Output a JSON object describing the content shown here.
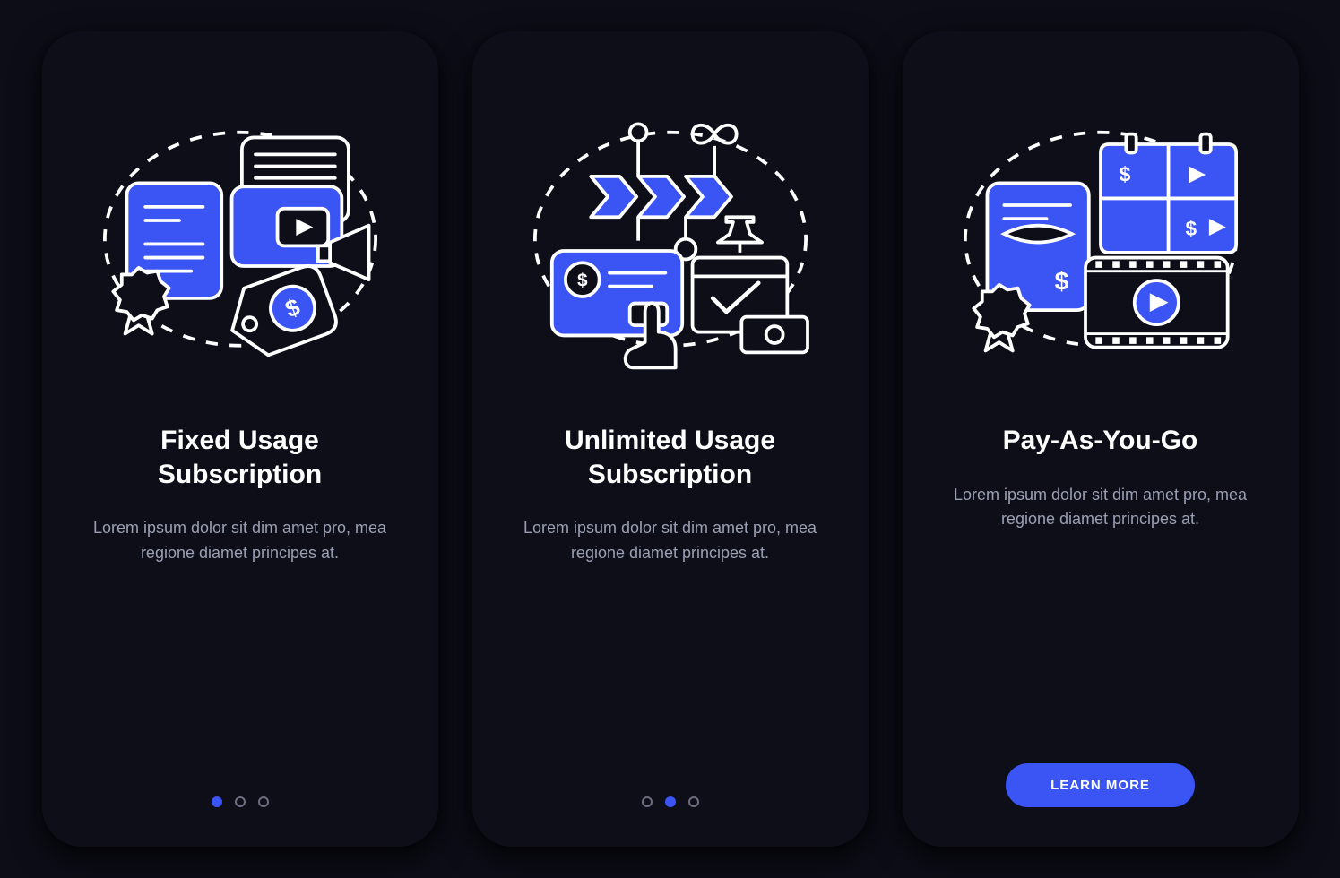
{
  "colors": {
    "accent": "#3b54f4",
    "stroke": "#ffffff",
    "panel": "#0d0e18",
    "bg": "#0c0d16",
    "muted": "#9aa0b4"
  },
  "screens": [
    {
      "icon": "fixed-usage-icon",
      "title": "Fixed Usage Subscription",
      "desc": "Lorem ipsum dolor sit dim amet pro, mea regione diamet principes at.",
      "pager": {
        "count": 3,
        "active": 0
      },
      "cta": null
    },
    {
      "icon": "unlimited-usage-icon",
      "title": "Unlimited Usage Subscription",
      "desc": "Lorem ipsum dolor sit dim amet pro, mea regione diamet principes at.",
      "pager": {
        "count": 3,
        "active": 1
      },
      "cta": null
    },
    {
      "icon": "pay-as-you-go-icon",
      "title": "Pay-As-You-Go",
      "desc": "Lorem ipsum dolor sit dim amet pro, mea regione diamet principes at.",
      "pager": null,
      "cta": "LEARN MORE"
    }
  ]
}
